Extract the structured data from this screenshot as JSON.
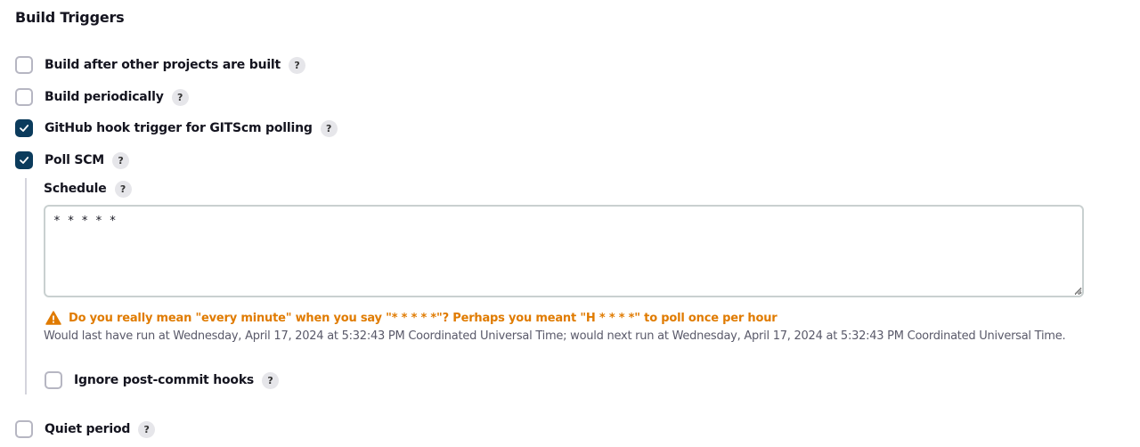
{
  "section": {
    "title": "Build Triggers"
  },
  "triggers": [
    {
      "label": "Build after other projects are built",
      "checked": false,
      "help": "?"
    },
    {
      "label": "Build periodically",
      "checked": false,
      "help": "?"
    },
    {
      "label": "GitHub hook trigger for GITScm polling",
      "checked": true,
      "help": "?"
    },
    {
      "label": "Poll SCM",
      "checked": true,
      "help": "?"
    }
  ],
  "poll_scm": {
    "schedule_label": "Schedule",
    "schedule_help": "?",
    "schedule_value": "* * * * *",
    "warning_icon": "warning-triangle-icon",
    "warning_color": "#e07b00",
    "warning_text": "Do you really mean \"every minute\" when you say \"* * * * *\"? Perhaps you meant \"H * * * *\" to poll once per hour",
    "info_text": "Would last have run at Wednesday, April 17, 2024 at 5:32:43 PM Coordinated Universal Time; would next run at Wednesday, April 17, 2024 at 5:32:43 PM Coordinated Universal Time.",
    "ignore_hooks": {
      "label": "Ignore post-commit hooks",
      "checked": false,
      "help": "?"
    }
  },
  "quiet_period": {
    "label": "Quiet period",
    "checked": false,
    "help": "?"
  },
  "colors": {
    "checkbox_checked": "#0b3b5c",
    "checkbox_border": "#b6b6c2",
    "help_bg": "#e6e6ea"
  }
}
